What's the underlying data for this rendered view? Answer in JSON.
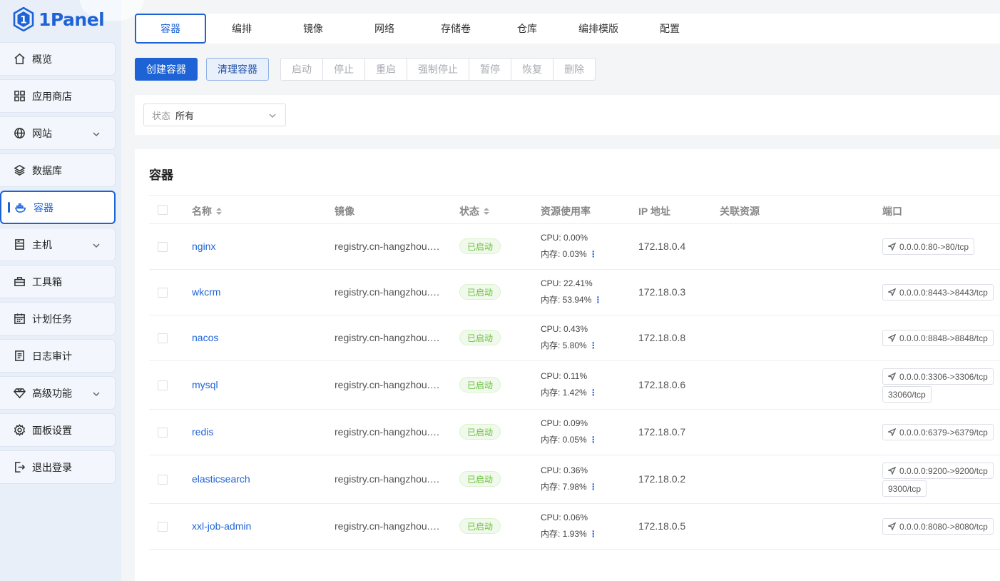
{
  "brand": {
    "name": "1Panel"
  },
  "sidebar": {
    "items": [
      {
        "label": "概览",
        "icon": "home-icon",
        "expandable": false
      },
      {
        "label": "应用商店",
        "icon": "grid-icon",
        "expandable": false
      },
      {
        "label": "网站",
        "icon": "globe-icon",
        "expandable": true
      },
      {
        "label": "数据库",
        "icon": "layers-icon",
        "expandable": false
      },
      {
        "label": "容器",
        "icon": "docker-icon",
        "expandable": false,
        "active": true
      },
      {
        "label": "主机",
        "icon": "server-icon",
        "expandable": true
      },
      {
        "label": "工具箱",
        "icon": "toolbox-icon",
        "expandable": false
      },
      {
        "label": "计划任务",
        "icon": "calendar-icon",
        "expandable": false
      },
      {
        "label": "日志审计",
        "icon": "log-icon",
        "expandable": false
      },
      {
        "label": "高级功能",
        "icon": "diamond-icon",
        "expandable": true
      },
      {
        "label": "面板设置",
        "icon": "gear-icon",
        "expandable": false
      },
      {
        "label": "退出登录",
        "icon": "logout-icon",
        "expandable": false
      }
    ]
  },
  "tabs": [
    "容器",
    "编排",
    "镜像",
    "网络",
    "存储卷",
    "仓库",
    "编排模版",
    "配置"
  ],
  "toolbar": {
    "create_label": "创建容器",
    "clean_label": "清理容器",
    "group": [
      "启动",
      "停止",
      "重启",
      "强制停止",
      "暂停",
      "恢复",
      "删除"
    ]
  },
  "filter": {
    "prefix": "状态",
    "value": "所有"
  },
  "card": {
    "title": "容器"
  },
  "table": {
    "headers": {
      "name": "名称",
      "image": "镜像",
      "status": "状态",
      "resource": "资源使用率",
      "ip": "IP 地址",
      "linked": "关联资源",
      "port": "端口"
    },
    "cpu_prefix": "CPU: ",
    "mem_prefix": "内存: ",
    "rows": [
      {
        "name": "nginx",
        "image": "registry.cn-hangzhou.aliyuncs.com/...",
        "status": "已启动",
        "cpu": "0.00%",
        "mem": "0.03%",
        "ip": "172.18.0.4",
        "ports": [
          "0.0.0.0:80->80/tcp"
        ]
      },
      {
        "name": "wkcrm",
        "image": "registry.cn-hangzhou.aliyuncs.com/...",
        "status": "已启动",
        "cpu": "22.41%",
        "mem": "53.94%",
        "ip": "172.18.0.3",
        "ports": [
          "0.0.0.0:8443->8443/tcp"
        ]
      },
      {
        "name": "nacos",
        "image": "registry.cn-hangzhou.aliyuncs.com/...",
        "status": "已启动",
        "cpu": "0.43%",
        "mem": "5.80%",
        "ip": "172.18.0.8",
        "ports": [
          "0.0.0.0:8848->8848/tcp"
        ]
      },
      {
        "name": "mysql",
        "image": "registry.cn-hangzhou.aliyuncs.com/...",
        "status": "已启动",
        "cpu": "0.11%",
        "mem": "1.42%",
        "ip": "172.18.0.6",
        "ports": [
          "0.0.0.0:3306->3306/tcp",
          "33060/tcp"
        ]
      },
      {
        "name": "redis",
        "image": "registry.cn-hangzhou.aliyuncs.com/...",
        "status": "已启动",
        "cpu": "0.09%",
        "mem": "0.05%",
        "ip": "172.18.0.7",
        "ports": [
          "0.0.0.0:6379->6379/tcp"
        ]
      },
      {
        "name": "elasticsearch",
        "image": "registry.cn-hangzhou.aliyuncs.com/...",
        "status": "已启动",
        "cpu": "0.36%",
        "mem": "7.98%",
        "ip": "172.18.0.2",
        "ports": [
          "0.0.0.0:9200->9200/tcp",
          "9300/tcp"
        ]
      },
      {
        "name": "xxl-job-admin",
        "image": "registry.cn-hangzhou.aliyuncs.com/...",
        "status": "已启动",
        "cpu": "0.06%",
        "mem": "1.93%",
        "ip": "172.18.0.5",
        "ports": [
          "0.0.0.0:8080->8080/tcp"
        ]
      }
    ]
  },
  "colors": {
    "accent": "#1e63d6",
    "success": "#67c23a",
    "sidebar_bg": "#e9eff9"
  }
}
